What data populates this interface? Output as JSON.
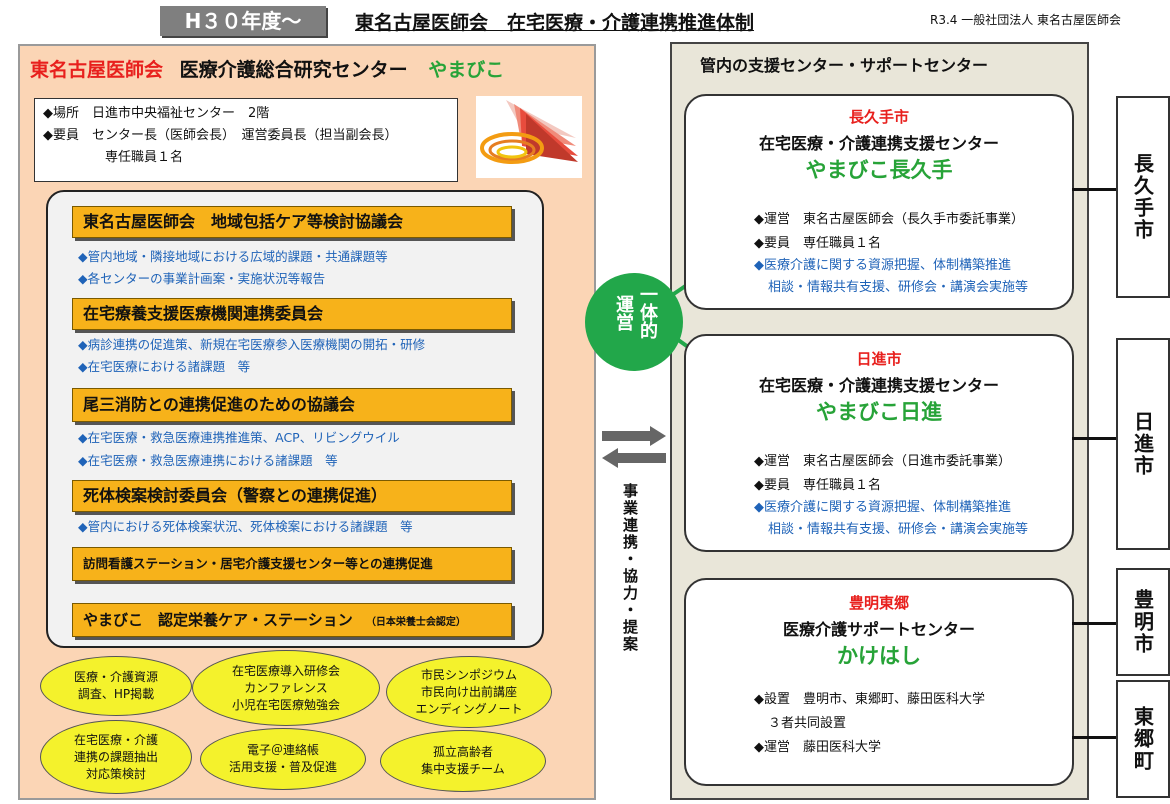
{
  "header": {
    "badge": "H３０年度～",
    "title": "東名古屋医師会　在宅医療・介護連携推進体制",
    "note": "R3.4 一般社団法人 東名古屋医師会"
  },
  "left": {
    "title_red": "東名古屋医師会",
    "title_mid": "医療介護総合研究センター",
    "title_green": "やまびこ",
    "info": [
      "◆場所　日進市中央福祉センター　2階",
      "◆要員　センター長（医師会長）　運営委員長（担当副会長）",
      "専任職員１名"
    ],
    "committees": [
      {
        "label": "東名古屋医師会　地域包括ケア等検討協議会",
        "bullets": [
          "◆管内地域・隣接地域における広域的課題・共通課題等",
          "◆各センターの事業計画案・実施状況等報告"
        ]
      },
      {
        "label": "在宅療養支援医療機関連携委員会",
        "bullets": [
          "◆病診連携の促進策、新規在宅医療参入医療機関の開拓・研修",
          "◆在宅医療における諸課題　等"
        ]
      },
      {
        "label": "尾三消防との連携促進のための協議会",
        "bullets": [
          "◆在宅医療・救急医療連携推進策、ACP、リビングウイル",
          "◆在宅医療・救急医療連携における諸課題　等"
        ]
      },
      {
        "label": "死体検案検討委員会（警察との連携促進）",
        "bullets": [
          "◆管内における死体検案状況、死体検案における諸課題　等"
        ]
      },
      {
        "label": "訪問看護ステーション・居宅介護支援センター等との連携促進",
        "bullets": []
      },
      {
        "label": "やまびこ　認定栄養ケア・ステーション",
        "sub": "（日本栄養士会認定）",
        "bullets": []
      }
    ],
    "activities": [
      [
        "医療・介護資源",
        "調査、HP掲載"
      ],
      [
        "在宅医療導入研修会",
        "カンファレンス",
        "小児在宅医療勉強会"
      ],
      [
        "市民シンポジウム",
        "市民向け出前講座",
        "エンディングノート"
      ],
      [
        "在宅医療・介護",
        "連携の課題抽出",
        "対応策検討"
      ],
      [
        "電子＠連絡帳",
        "活用支援・普及促進"
      ],
      [
        "孤立高齢者",
        "集中支援チーム"
      ]
    ]
  },
  "center": {
    "circle_left": "運営",
    "circle_right": "一体的",
    "cooperation": "事業連携・協力・提案"
  },
  "right": {
    "title": "管内の支援センター・サポートセンター",
    "centers": [
      {
        "city": "長久手市",
        "type": "在宅医療・介護連携支援センター",
        "name": "やまびこ長久手",
        "lines": [
          "◆運営　東名古屋医師会（長久手市委託事業）",
          "◆要員　専任職員１名"
        ],
        "blue": [
          "◆医療介護に関する資源把握、体制構築推進",
          "相談・情報共有支援、研修会・講演会実施等"
        ]
      },
      {
        "city": "日進市",
        "type": "在宅医療・介護連携支援センター",
        "name": "やまびこ日進",
        "lines": [
          "◆運営　東名古屋医師会（日進市委託事業）",
          "◆要員　専任職員１名"
        ],
        "blue": [
          "◆医療介護に関する資源把握、体制構築推進",
          "相談・情報共有支援、研修会・講演会実施等"
        ]
      },
      {
        "city": "豊明東郷",
        "type": "医療介護サポートセンター",
        "name": "かけはし",
        "lines": [
          "◆設置　豊明市、東郷町、藤田医科大学",
          "３者共同設置",
          "◆運営　藤田医科大学"
        ],
        "blue": []
      }
    ],
    "side_labels": [
      "長久手市",
      "日進市",
      "豊明市",
      "東郷町"
    ]
  },
  "colors": {
    "orange": "#f7b21a",
    "peach": "#fbd5b5",
    "green": "#22a74a",
    "red": "#e8201d",
    "yellow": "#f4f22c",
    "blue": "#1f63b8"
  }
}
